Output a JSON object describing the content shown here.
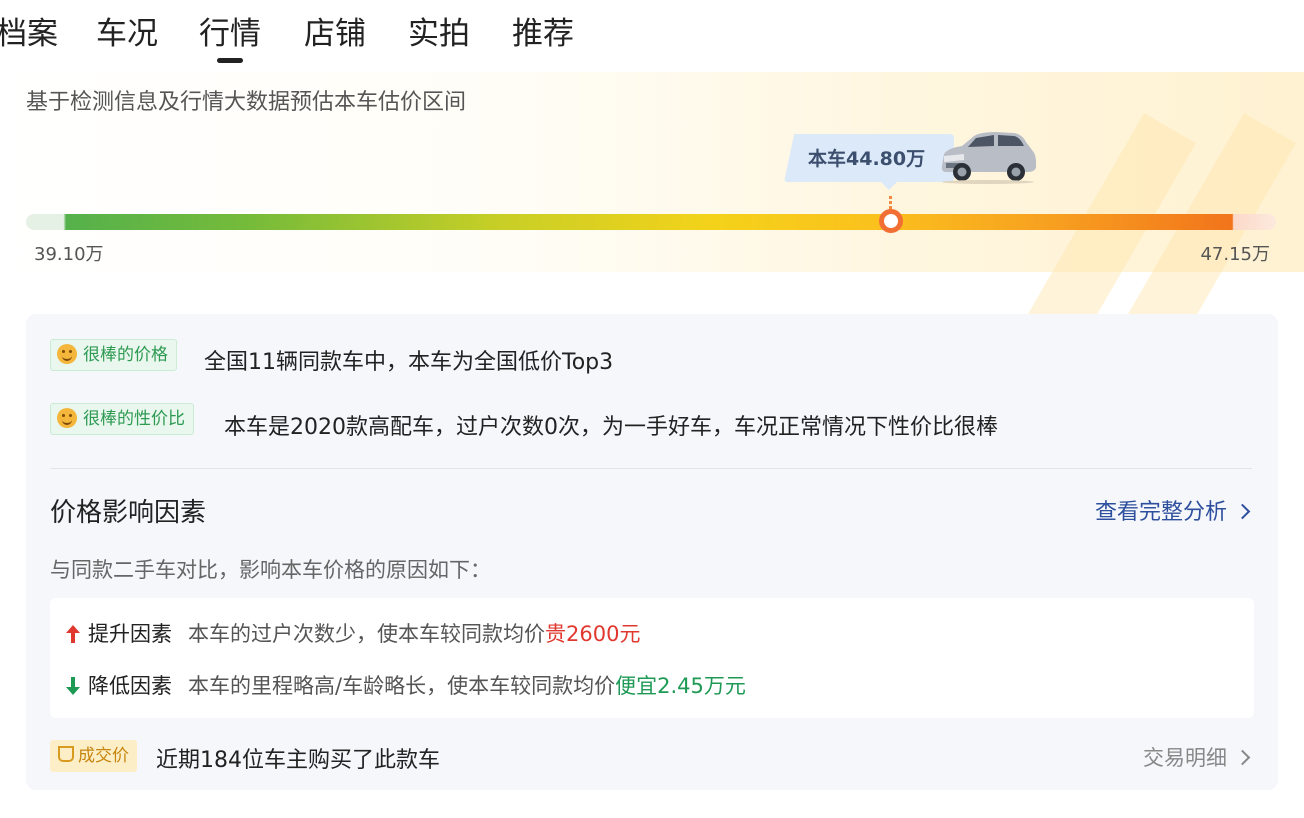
{
  "tabs": [
    "档案",
    "车况",
    "行情",
    "店铺",
    "实拍",
    "推荐"
  ],
  "active_tab": "行情",
  "estimate": {
    "subtitle": "基于检测信息及行情大数据预估本车估价区间",
    "car_price_label": "本车44.80万",
    "range_min": "39.10万",
    "range_max": "47.15万",
    "car_price_value": 44.8,
    "range_min_value": 39.1,
    "range_max_value": 47.15
  },
  "highlights": [
    {
      "badge": "很棒的价格",
      "text": "全国11辆同款车中，本车为全国低价Top3"
    },
    {
      "badge": "很棒的性价比",
      "text": "本车是2020款高配车，过户次数0次，为一手好车，车况正常情况下性价比很棒"
    }
  ],
  "factors": {
    "title": "价格影响因素",
    "link": "查看完整分析",
    "description": "与同款二手车对比，影响本车价格的原因如下：",
    "up": {
      "label": "提升因素",
      "desc": "本车的过户次数少，使本车较同款均价",
      "value": "贵2600元"
    },
    "down": {
      "label": "降低因素",
      "desc": "本车的里程略高/车龄略长，使本车较同款均价",
      "value": "便宜2.45万元"
    }
  },
  "deal": {
    "badge": "成交价",
    "text": "近期184位车主购买了此款车",
    "link": "交易明细"
  },
  "colors": {
    "accent_orange": "#f26f34",
    "up_red": "#e0382f",
    "down_green": "#1f9a55",
    "link_blue": "#2e4f9e"
  }
}
